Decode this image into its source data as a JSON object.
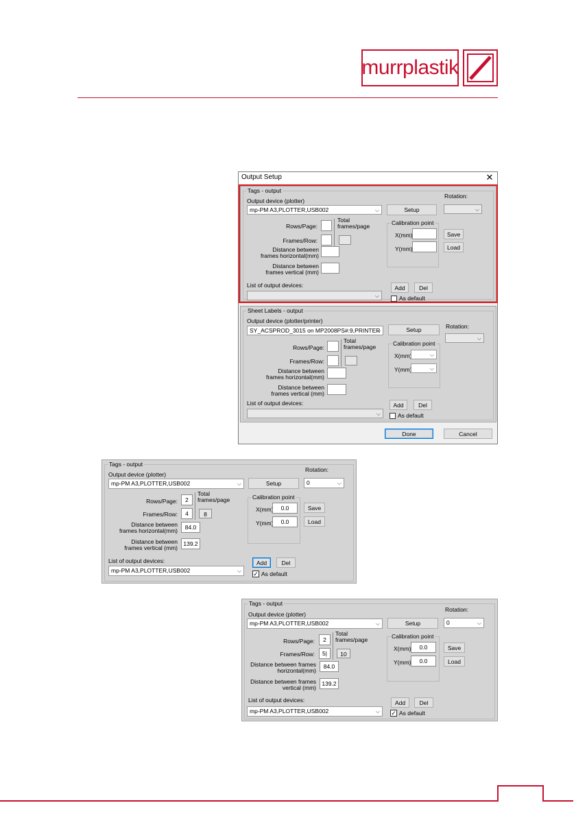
{
  "logo": {
    "text": "murrplastik",
    "accent": "#c8102e"
  },
  "dialog_main": {
    "title": "Output Setup",
    "tags": {
      "group_title": "Tags - output",
      "device_label": "Output device (plotter)",
      "device_value": "mp-PM A3,PLOTTER,USB002",
      "setup": "Setup",
      "rotation_label": "Rotation:",
      "rotation_value": "",
      "rows_label": "Rows/Page:",
      "rows_value": "",
      "frames_label": "Frames/Row:",
      "frames_value": "",
      "total_label": "Total frames/page",
      "total_value": "",
      "dist_h_label": "Distance between frames horizontal(mm)",
      "dist_h_value": "",
      "dist_v_label": "Distance between frames vertical (mm)",
      "dist_v_value": "",
      "calib_title": "Calibration point",
      "x_label": "X(mm)",
      "x_value": "",
      "y_label": "Y(mm)",
      "y_value": "",
      "save": "Save",
      "load": "Load",
      "list_label": "List of output devices:",
      "list_value": "",
      "add": "Add",
      "del": "Del",
      "as_default": "As default"
    },
    "sheet": {
      "group_title": "Sheet Labels - output",
      "device_label": "Output device (plotter/printer)",
      "device_value": "SY_ACSPROD_3015 on MP2008PS#:9,PRINTER",
      "setup": "Setup",
      "rotation_label": "Rotation:",
      "rows_label": "Rows/Page:",
      "frames_label": "Frames/Row:",
      "total_label": "Total frames/page",
      "dist_h_label": "Distance between frames horizontal(mm)",
      "dist_v_label": "Distance between frames vertical (mm)",
      "calib_title": "Calibration point",
      "x_label": "X(mm)",
      "y_label": "Y(mm)",
      "list_label": "List of output devices:",
      "add": "Add",
      "del": "Del",
      "as_default": "As default"
    },
    "done": "Done",
    "cancel": "Cancel"
  },
  "tags_example1": {
    "group_title": "Tags - output",
    "device_label": "Output device (plotter)",
    "device_value": "mp-PM A3,PLOTTER,USB002",
    "setup": "Setup",
    "rotation_label": "Rotation:",
    "rotation_value": "0",
    "rows_label": "Rows/Page:",
    "rows_value": "2",
    "frames_label": "Frames/Row:",
    "frames_value": "4",
    "total_label": "Total frames/page",
    "total_value": "8",
    "dist_h_label": "Distance between frames horizontal(mm)",
    "dist_h_value": "84.0",
    "dist_v_label": "Distance between frames vertical (mm)",
    "dist_v_value": "139.2",
    "calib_title": "Calibration point",
    "x_label": "X(mm)",
    "x_value": "0.0",
    "y_label": "Y(mm)",
    "y_value": "0.0",
    "save": "Save",
    "load": "Load",
    "list_label": "List of output devices:",
    "list_value": "mp-PM A3,PLOTTER,USB002",
    "add": "Add",
    "del": "Del",
    "as_default": "As default",
    "checkmark": "✓"
  },
  "tags_example2": {
    "group_title": "Tags - output",
    "device_label": "Output device (plotter)",
    "device_value": "mp-PM A3,PLOTTER,USB002",
    "setup": "Setup",
    "rotation_label": "Rotation:",
    "rotation_value": "0",
    "rows_label": "Rows/Page:",
    "rows_value": "2",
    "frames_label": "Frames/Row:",
    "frames_value": "5|",
    "total_label": "Total frames/page",
    "total_value": "10",
    "dist_h_label": "Distance between frames horizontal(mm)",
    "dist_h_value": "84.0",
    "dist_v_label": "Distance between frames vertical (mm)",
    "dist_v_value": "139.2",
    "calib_title": "Calibration point",
    "x_label": "X(mm)",
    "x_value": "0.0",
    "y_label": "Y(mm)",
    "y_value": "0.0",
    "save": "Save",
    "load": "Load",
    "list_label": "List of output devices:",
    "list_value": "mp-PM A3,PLOTTER,USB002",
    "add": "Add",
    "del": "Del",
    "as_default": "As default",
    "checkmark": "✓"
  }
}
